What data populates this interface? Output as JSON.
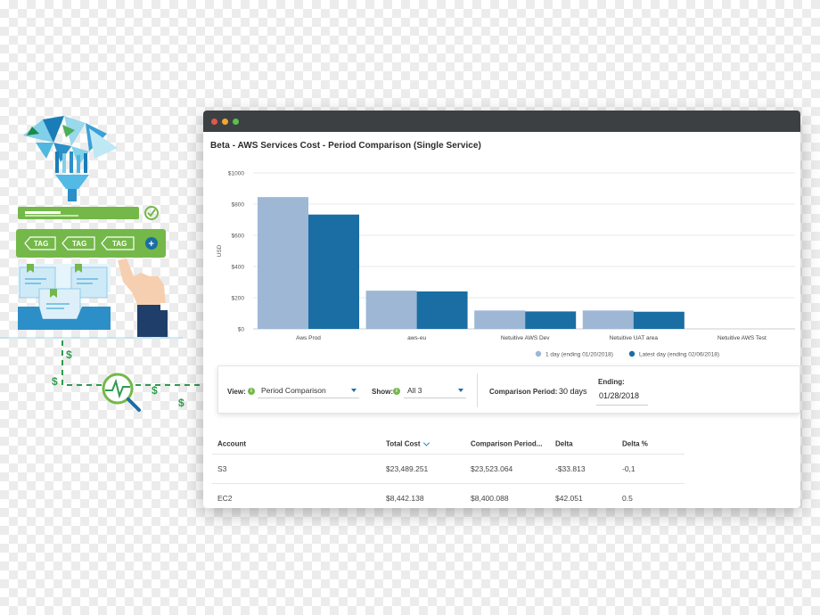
{
  "window": {
    "chart_title": "Beta - AWS Services Cost - Period Comparison (Single Service)"
  },
  "illustration": {
    "tag_label": "TAG",
    "dollar_sign": "$",
    "plus_sign": "+"
  },
  "controls": {
    "view_label": "View:",
    "view_value": "Period Comparison",
    "show_label": "Show:",
    "show_value": "All 3",
    "comparison_period_label": "Comparison Period:",
    "comparison_period_value": "30 days",
    "ending_label": "Ending:",
    "ending_value": "01/28/2018",
    "info_glyph": "i"
  },
  "table": {
    "headers": [
      "Account",
      "Total Cost",
      "Comparison Period...",
      "Delta",
      "Delta %"
    ],
    "rows": [
      [
        "S3",
        "$23,489.251",
        "$23,523.064",
        "-$33.813",
        "-0,1"
      ],
      [
        "EC2",
        "$8,442.138",
        "$8,400.088",
        "$42.051",
        "0.5"
      ]
    ]
  },
  "colors": {
    "series_1": "#9db7d5",
    "series_2": "#1a6ea3",
    "titlebar": "#3d4043",
    "dot_red": "#e2574c",
    "dot_yellow": "#f1a731",
    "dot_green": "#5cc04a",
    "accent_green": "#74b84a"
  },
  "chart_data": {
    "type": "bar",
    "ylabel": "USD",
    "ylim": [
      0,
      1000
    ],
    "y_ticks": [
      "$0",
      "$200",
      "$400",
      "$600",
      "$800",
      "$1000"
    ],
    "y_tick_values": [
      0,
      200,
      400,
      600,
      800,
      1000
    ],
    "categories": [
      "Aws Prod",
      "aws-eu",
      "Netuitive AWS Dev",
      "Netuitive UAT area",
      "Netuitive AWS Test"
    ],
    "series": [
      {
        "name": "1 day (ending 01/20/2018)",
        "values": [
          845,
          245,
          118,
          118,
          0
        ]
      },
      {
        "name": "Latest day (ending 02/06/2018)",
        "values": [
          733,
          240,
          112,
          110,
          0
        ]
      }
    ],
    "legend_position": "bottom-right",
    "grid": true
  }
}
